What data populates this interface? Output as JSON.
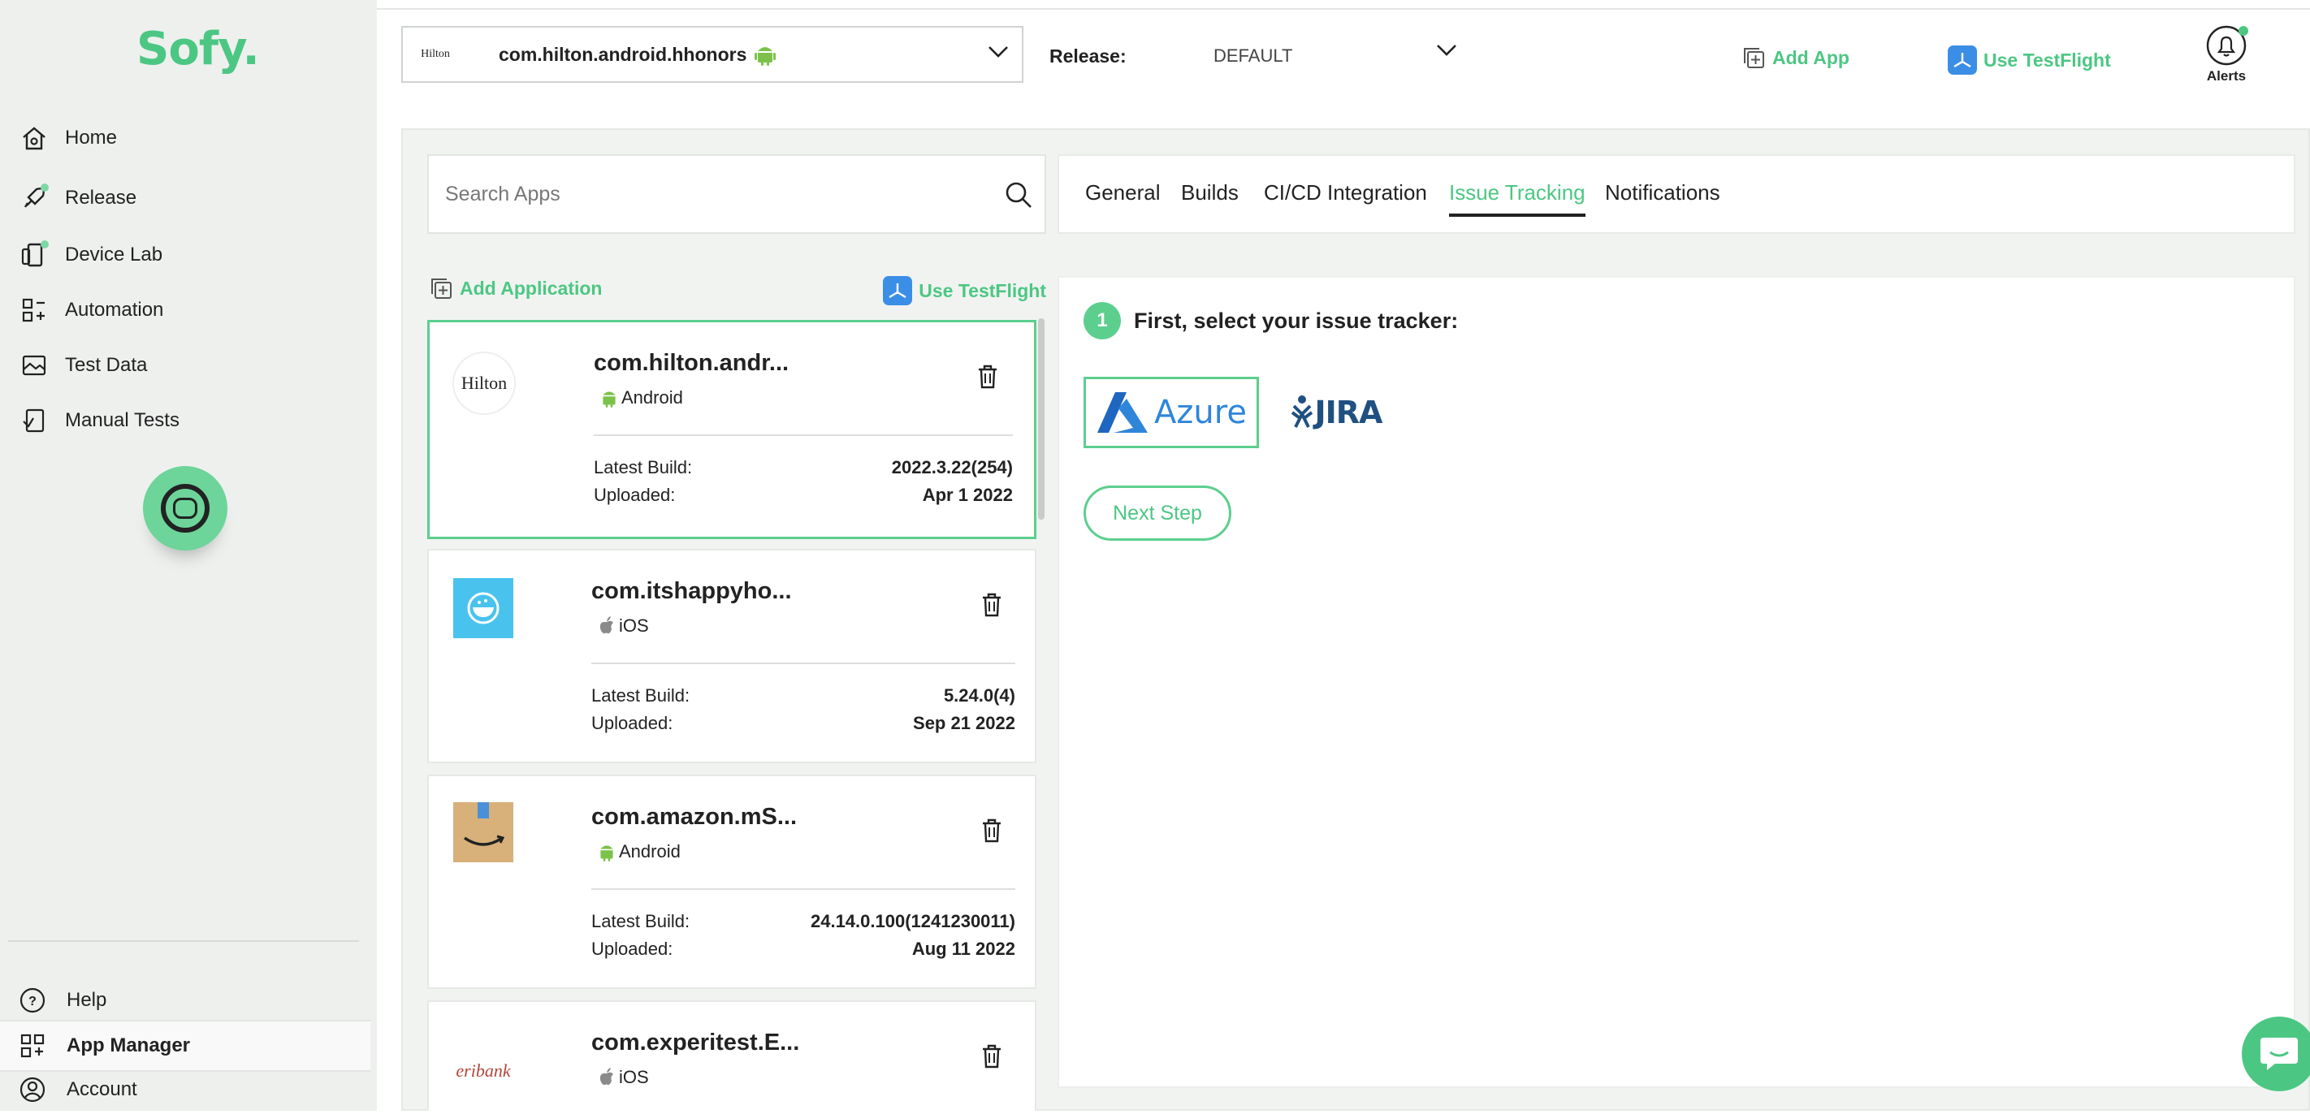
{
  "brand": {
    "logo": "Sofy.",
    "accent": "#4cc783"
  },
  "sidebar": {
    "items": [
      {
        "label": "Home",
        "icon": "home-icon"
      },
      {
        "label": "Release",
        "icon": "rocket-icon"
      },
      {
        "label": "Device Lab",
        "icon": "devices-icon"
      },
      {
        "label": "Automation",
        "icon": "automation-icon"
      },
      {
        "label": "Test Data",
        "icon": "test-data-icon"
      },
      {
        "label": "Manual Tests",
        "icon": "manual-tests-icon"
      }
    ],
    "bottom": [
      {
        "label": "Help",
        "icon": "help-icon"
      },
      {
        "label": "App Manager",
        "icon": "app-manager-icon"
      },
      {
        "label": "Account",
        "icon": "account-icon"
      }
    ]
  },
  "header": {
    "app_logo_text": "Hilton",
    "selected_app": "com.hilton.android.hhonors",
    "release_label": "Release:",
    "release_value": "DEFAULT",
    "add_app": "Add App",
    "use_testflight": "Use TestFlight",
    "alerts": "Alerts"
  },
  "search": {
    "placeholder": "Search Apps"
  },
  "tabs": [
    "General",
    "Builds",
    "CI/CD Integration",
    "Issue Tracking",
    "Notifications"
  ],
  "active_tab": "Issue Tracking",
  "list_actions": {
    "add_application": "Add Application",
    "use_testflight": "Use TestFlight"
  },
  "apps": [
    {
      "name": "com.hilton.andr...",
      "platform": "Android",
      "latest_build_label": "Latest Build:",
      "latest_build": "2022.3.22(254)",
      "uploaded_label": "Uploaded:",
      "uploaded": "Apr 1 2022",
      "logo_text": "Hilton"
    },
    {
      "name": "com.itshappyho...",
      "platform": "iOS",
      "latest_build_label": "Latest Build:",
      "latest_build": "5.24.0(4)",
      "uploaded_label": "Uploaded:",
      "uploaded": "Sep 21 2022"
    },
    {
      "name": "com.amazon.mS...",
      "platform": "Android",
      "latest_build_label": "Latest Build:",
      "latest_build": "24.14.0.100(1241230011)",
      "uploaded_label": "Uploaded:",
      "uploaded": "Aug 11 2022"
    },
    {
      "name": "com.experitest.E...",
      "platform": "iOS",
      "logo_text": "eribank"
    }
  ],
  "issue_tracking": {
    "step_number": "1",
    "step_title": "First, select your issue tracker:",
    "trackers": [
      "Azure",
      "JIRA"
    ],
    "next_button": "Next Step"
  }
}
